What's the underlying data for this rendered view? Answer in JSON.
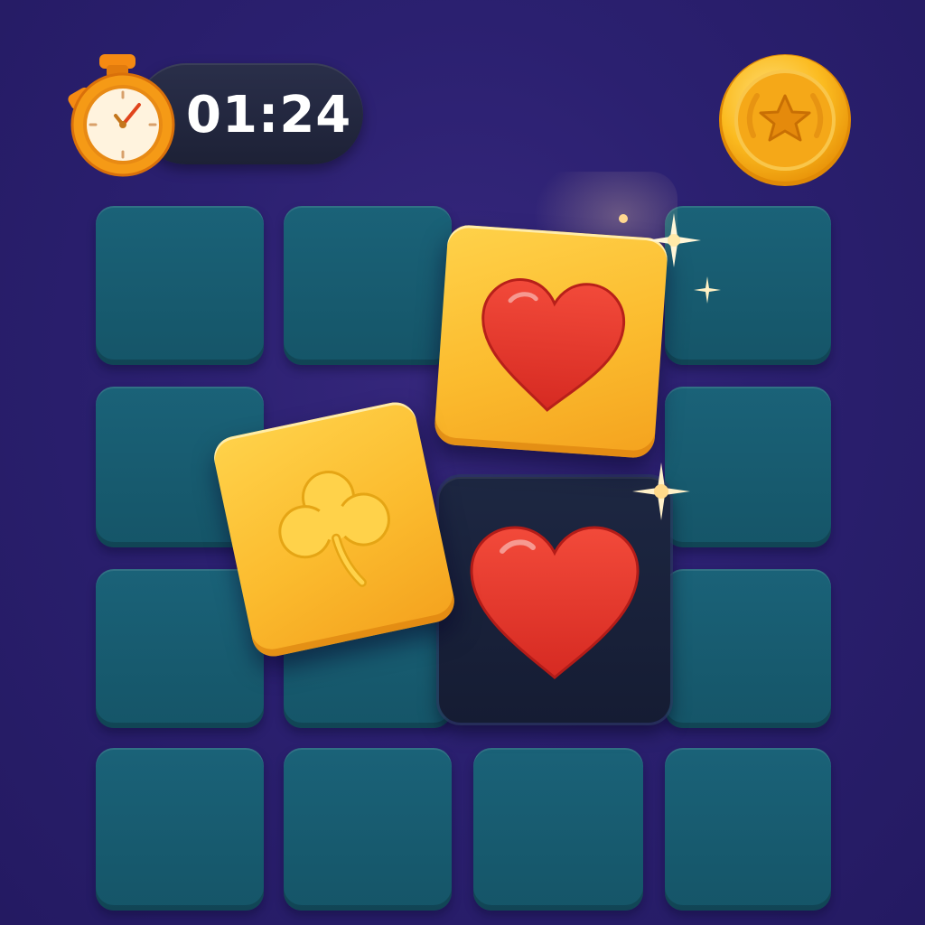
{
  "hud": {
    "timer": {
      "value": "01:24",
      "icon": "stopwatch-icon"
    },
    "coin": {
      "icon": "star-coin-icon"
    }
  },
  "board": {
    "rows": 4,
    "columns": 4,
    "face_down_color": "#1a6278",
    "card_face_color": "#fbbb2e",
    "revealed_cards": [
      {
        "symbol": "heart",
        "color": "#e8302c",
        "style": "gold",
        "state": "flipped"
      },
      {
        "symbol": "clover",
        "color": "#ffd040",
        "style": "gold",
        "state": "flipped"
      },
      {
        "symbol": "heart",
        "color": "#e8302c",
        "style": "dark",
        "state": "matched"
      }
    ]
  },
  "colors": {
    "background": "#2b2070",
    "timer_pill": "#1d2136",
    "accent_gold": "#fbbb2e",
    "heart_red": "#e8302c"
  }
}
